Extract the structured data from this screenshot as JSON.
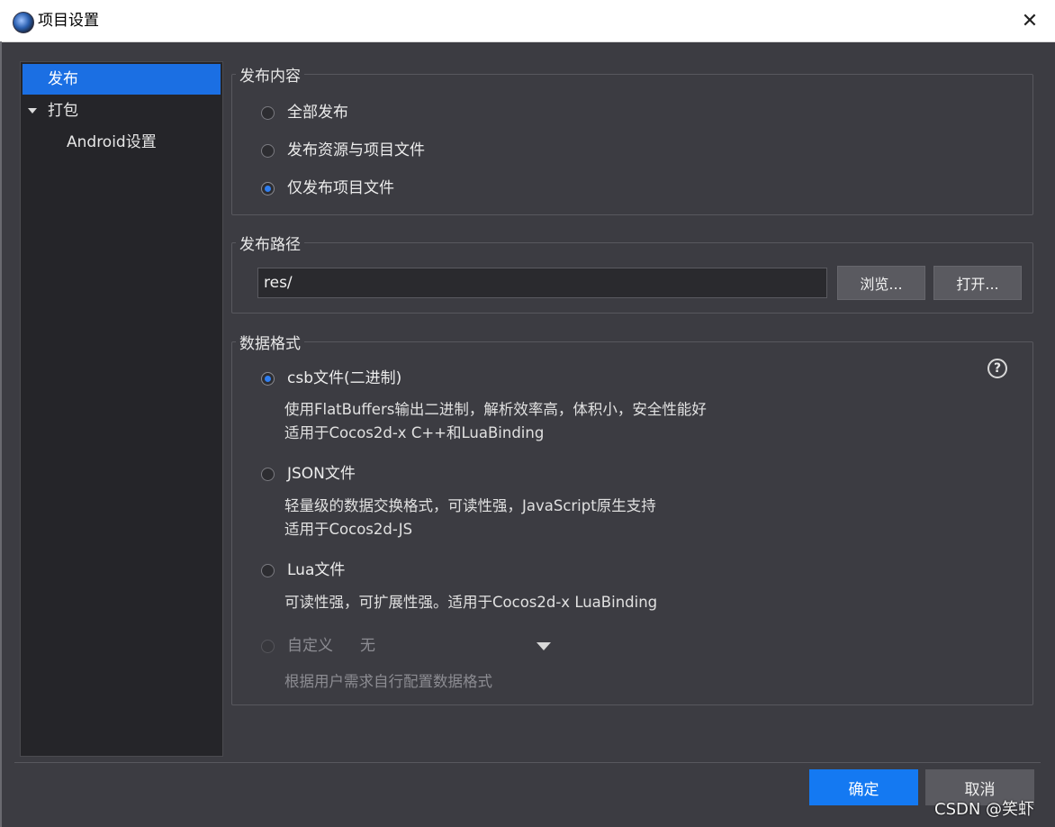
{
  "window": {
    "title": "项目设置",
    "close_symbol": "✕"
  },
  "sidebar": {
    "items": [
      {
        "label": "发布",
        "selected": true
      },
      {
        "label": "打包",
        "expanded": true
      },
      {
        "label": "Android设置"
      }
    ]
  },
  "publish_content": {
    "title": "发布内容",
    "options": [
      {
        "label": "全部发布",
        "checked": false
      },
      {
        "label": "发布资源与项目文件",
        "checked": false
      },
      {
        "label": "仅发布项目文件",
        "checked": true
      }
    ]
  },
  "publish_path": {
    "title": "发布路径",
    "value": "res/",
    "browse_label": "浏览...",
    "open_label": "打开..."
  },
  "data_format": {
    "title": "数据格式",
    "help_symbol": "?",
    "options": [
      {
        "label": "csb文件(二进制)",
        "checked": true,
        "desc1": "使用FlatBuffers输出二进制，解析效率高，体积小，安全性能好",
        "desc2": "适用于Cocos2d-x C++和LuaBinding"
      },
      {
        "label": "JSON文件",
        "checked": false,
        "desc1": "轻量级的数据交换格式，可读性强，JavaScript原生支持",
        "desc2": "适用于Cocos2d-JS"
      },
      {
        "label": "Lua文件",
        "checked": false,
        "desc1": "可读性强，可扩展性强。适用于Cocos2d-x LuaBinding"
      },
      {
        "label": "自定义",
        "checked": false,
        "disabled": true,
        "select_value": "无",
        "desc1": "根据用户需求自行配置数据格式"
      }
    ]
  },
  "footer": {
    "ok_label": "确定",
    "cancel_label": "取消"
  },
  "watermark": "CSDN @笑虾",
  "colors": {
    "accent": "#1479f2",
    "selected": "#1b6fe3",
    "background": "#3c3c42",
    "sidebar": "#252529"
  }
}
